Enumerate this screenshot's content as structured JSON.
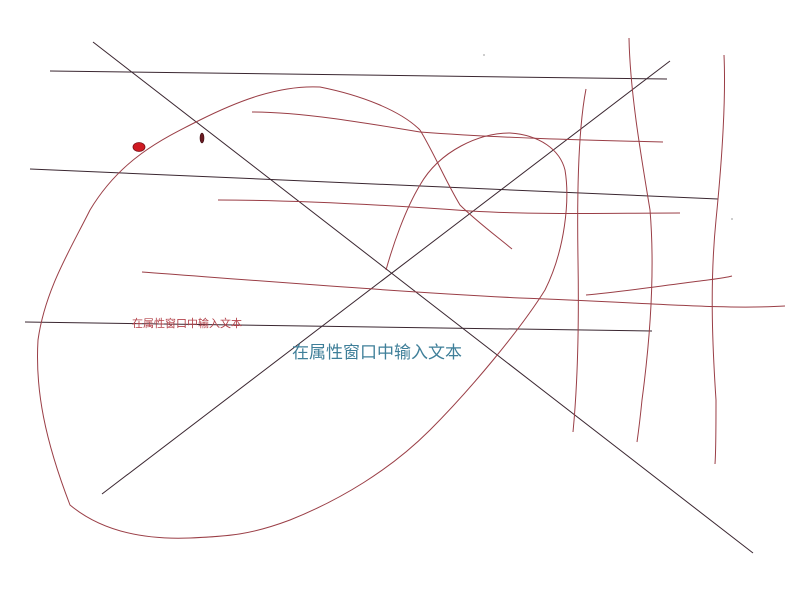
{
  "canvas": {
    "background": "#ffffff",
    "stroke_colors": {
      "dark_line": "#3a2630",
      "freehand": "#9a3e46",
      "marker_fill": "#cf1a22"
    }
  },
  "text_objects": [
    {
      "text": "在属性窗口中输入文本",
      "color": "#b3424a"
    },
    {
      "text": "在属性窗口中输入文本",
      "color": "#3f7f99"
    }
  ]
}
